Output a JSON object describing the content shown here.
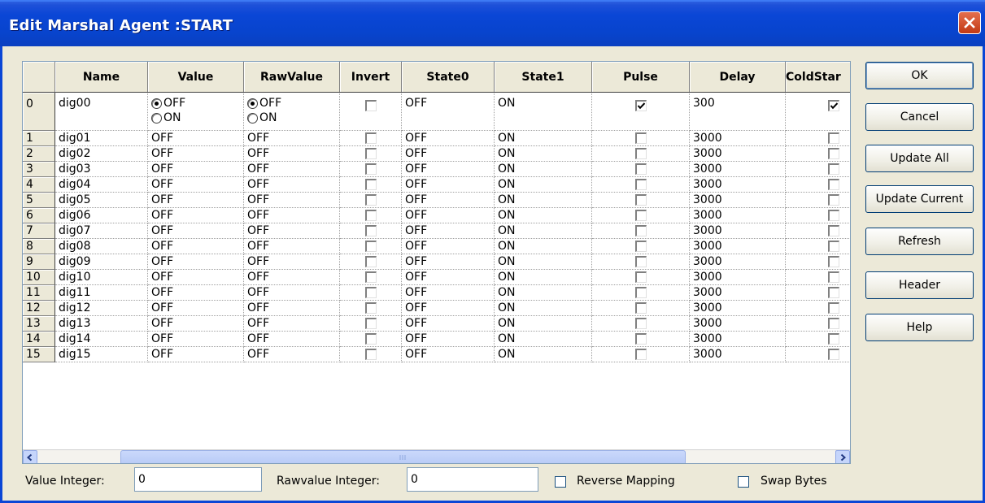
{
  "window": {
    "title": "Edit Marshal Agent :START"
  },
  "grid": {
    "columns": [
      "Name",
      "Value",
      "RawValue",
      "Invert",
      "State0",
      "State1",
      "Pulse",
      "Delay",
      "ColdStar"
    ],
    "radio_off": "OFF",
    "radio_on": "ON",
    "rows": [
      {
        "idx": "0",
        "name": "dig00",
        "value": "OFF",
        "raw": "OFF",
        "invert": false,
        "state0": "OFF",
        "state1": "ON",
        "pulse": true,
        "delay": "300",
        "coldstart": true
      },
      {
        "idx": "1",
        "name": "dig01",
        "value": "OFF",
        "raw": "OFF",
        "invert": false,
        "state0": "OFF",
        "state1": "ON",
        "pulse": false,
        "delay": "3000",
        "coldstart": false
      },
      {
        "idx": "2",
        "name": "dig02",
        "value": "OFF",
        "raw": "OFF",
        "invert": false,
        "state0": "OFF",
        "state1": "ON",
        "pulse": false,
        "delay": "3000",
        "coldstart": false
      },
      {
        "idx": "3",
        "name": "dig03",
        "value": "OFF",
        "raw": "OFF",
        "invert": false,
        "state0": "OFF",
        "state1": "ON",
        "pulse": false,
        "delay": "3000",
        "coldstart": false
      },
      {
        "idx": "4",
        "name": "dig04",
        "value": "OFF",
        "raw": "OFF",
        "invert": false,
        "state0": "OFF",
        "state1": "ON",
        "pulse": false,
        "delay": "3000",
        "coldstart": false
      },
      {
        "idx": "5",
        "name": "dig05",
        "value": "OFF",
        "raw": "OFF",
        "invert": false,
        "state0": "OFF",
        "state1": "ON",
        "pulse": false,
        "delay": "3000",
        "coldstart": false
      },
      {
        "idx": "6",
        "name": "dig06",
        "value": "OFF",
        "raw": "OFF",
        "invert": false,
        "state0": "OFF",
        "state1": "ON",
        "pulse": false,
        "delay": "3000",
        "coldstart": false
      },
      {
        "idx": "7",
        "name": "dig07",
        "value": "OFF",
        "raw": "OFF",
        "invert": false,
        "state0": "OFF",
        "state1": "ON",
        "pulse": false,
        "delay": "3000",
        "coldstart": false
      },
      {
        "idx": "8",
        "name": "dig08",
        "value": "OFF",
        "raw": "OFF",
        "invert": false,
        "state0": "OFF",
        "state1": "ON",
        "pulse": false,
        "delay": "3000",
        "coldstart": false
      },
      {
        "idx": "9",
        "name": "dig09",
        "value": "OFF",
        "raw": "OFF",
        "invert": false,
        "state0": "OFF",
        "state1": "ON",
        "pulse": false,
        "delay": "3000",
        "coldstart": false
      },
      {
        "idx": "10",
        "name": "dig10",
        "value": "OFF",
        "raw": "OFF",
        "invert": false,
        "state0": "OFF",
        "state1": "ON",
        "pulse": false,
        "delay": "3000",
        "coldstart": false
      },
      {
        "idx": "11",
        "name": "dig11",
        "value": "OFF",
        "raw": "OFF",
        "invert": false,
        "state0": "OFF",
        "state1": "ON",
        "pulse": false,
        "delay": "3000",
        "coldstart": false
      },
      {
        "idx": "12",
        "name": "dig12",
        "value": "OFF",
        "raw": "OFF",
        "invert": false,
        "state0": "OFF",
        "state1": "ON",
        "pulse": false,
        "delay": "3000",
        "coldstart": false
      },
      {
        "idx": "13",
        "name": "dig13",
        "value": "OFF",
        "raw": "OFF",
        "invert": false,
        "state0": "OFF",
        "state1": "ON",
        "pulse": false,
        "delay": "3000",
        "coldstart": false
      },
      {
        "idx": "14",
        "name": "dig14",
        "value": "OFF",
        "raw": "OFF",
        "invert": false,
        "state0": "OFF",
        "state1": "ON",
        "pulse": false,
        "delay": "3000",
        "coldstart": false
      },
      {
        "idx": "15",
        "name": "dig15",
        "value": "OFF",
        "raw": "OFF",
        "invert": false,
        "state0": "OFF",
        "state1": "ON",
        "pulse": false,
        "delay": "3000",
        "coldstart": false
      }
    ]
  },
  "buttons": {
    "ok": "OK",
    "cancel": "Cancel",
    "update_all": "Update All",
    "update_current": "Update Current",
    "refresh": "Refresh",
    "header": "Header",
    "help": "Help"
  },
  "bottom": {
    "value_integer_label": "Value Integer:",
    "value_integer": "0",
    "rawvalue_integer_label": "Rawvalue Integer:",
    "rawvalue_integer": "0",
    "reverse_mapping_label": "Reverse Mapping",
    "reverse_mapping": false,
    "swap_bytes_label": "Swap Bytes",
    "swap_bytes": false
  },
  "colors": {
    "titlebar": "#0a46d6",
    "close": "#c23a14",
    "face": "#ece9d8"
  },
  "icons": [
    "close-icon",
    "scroll-left-icon",
    "scroll-right-icon",
    "check-icon"
  ]
}
